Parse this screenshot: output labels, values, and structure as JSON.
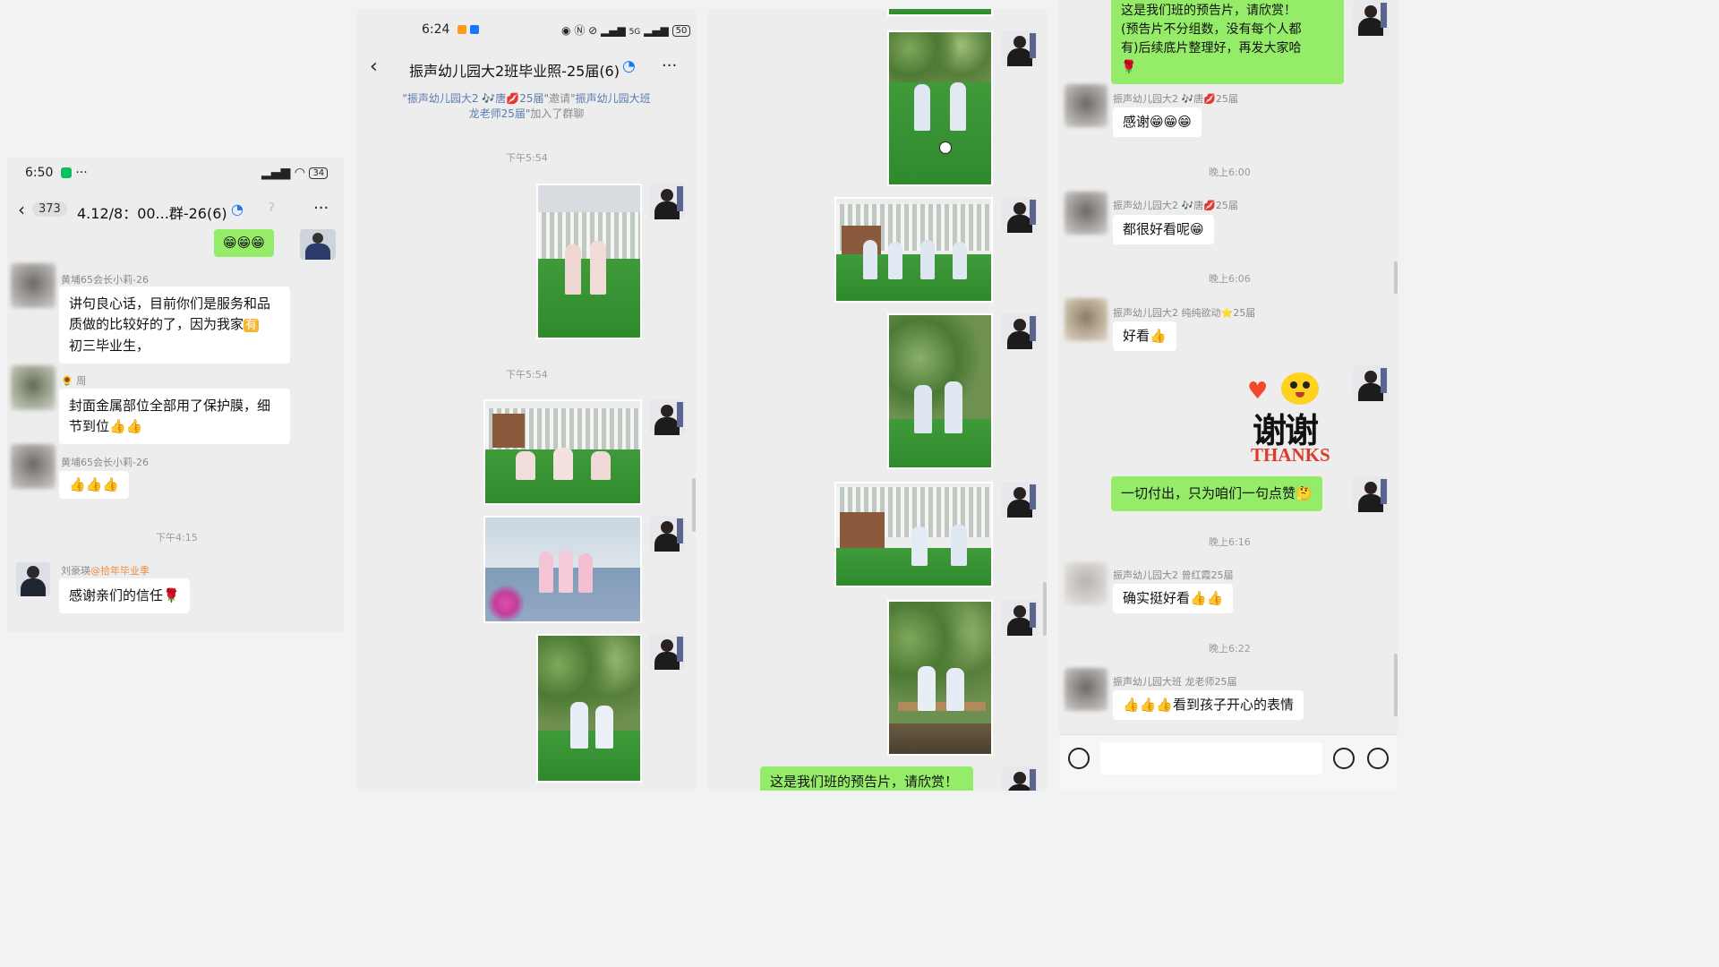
{
  "panel1": {
    "status_time": "6:50",
    "status_extra": "···",
    "battery": "34",
    "badge": "373",
    "title": "4.12/8：00...群-26(6)",
    "more": "···",
    "top_bubble": "😁😁😁",
    "messages": [
      {
        "sender": "黄埔65会长小莉-26",
        "text": "讲句良心话，目前你们是服务和品质做的比较好的了，因为我家"
      },
      {
        "sender_icon": "🌻",
        "sender": "周",
        "text": "封面金属部位全部用了保护膜，细节到位👍👍"
      },
      {
        "sender": "黄埔65会长小莉-26",
        "text": "👍👍👍"
      }
    ],
    "msg1_badge": "有",
    "msg1_line3": "初三毕业生，",
    "timestamp": "下午4:15",
    "last_sender_name": "刘豪瑛",
    "last_sender_tag": "@拾年毕业季",
    "last_text": "感谢亲们的信任🌹"
  },
  "panel2": {
    "status_time": "6:24",
    "status_right": "5G",
    "battery": "50",
    "title": "振声幼儿园大2班毕业照-25届(6)",
    "more": "···",
    "sys_quote1": "\"振声幼儿园大2 🎶唐💋25届\"",
    "sys_invite": "邀请",
    "sys_quote2": "\"振声幼儿园大班",
    "sys_quote3": "龙老师25届\"",
    "sys_joined": "加入了群聊",
    "ts1": "下午5:54",
    "ts2": "下午5:54"
  },
  "panel3": {
    "bottom_bubble": "这是我们班的预告片，请欣赏！"
  },
  "panel4": {
    "top_bubble_line1": "这是我们班的预告片，请欣赏！",
    "top_bubble_line2": "(预告片不分组数，没有每个人都",
    "top_bubble_line3": "有)后续底片整理好，再发大家哈",
    "top_bubble_line4": "🌹",
    "messages": [
      {
        "sender": "振声幼儿园大2 🎶唐💋25届",
        "text": "感谢😁😁😁"
      },
      {
        "sender": "振声幼儿园大2 🎶唐💋25届",
        "text": "都很好看呢😁"
      },
      {
        "sender": "振声幼儿园大2 纯纯欲动⭐25届",
        "text": "好看👍"
      },
      {
        "sender": "振声幼儿园大2 曾红霞25届",
        "text": "确实挺好看👍👍"
      },
      {
        "sender": "振声幼儿园大班 龙老师25届",
        "text": "👍👍👍看到孩子开心的表情"
      }
    ],
    "ts1": "晚上6:00",
    "ts2": "晚上6:06",
    "ts3": "晚上6:16",
    "ts4": "晚上6:22",
    "sticker_cn": "谢谢",
    "sticker_en": "THANKS",
    "my_bubble": "一切付出，只为咱们一句点赞🤔"
  }
}
